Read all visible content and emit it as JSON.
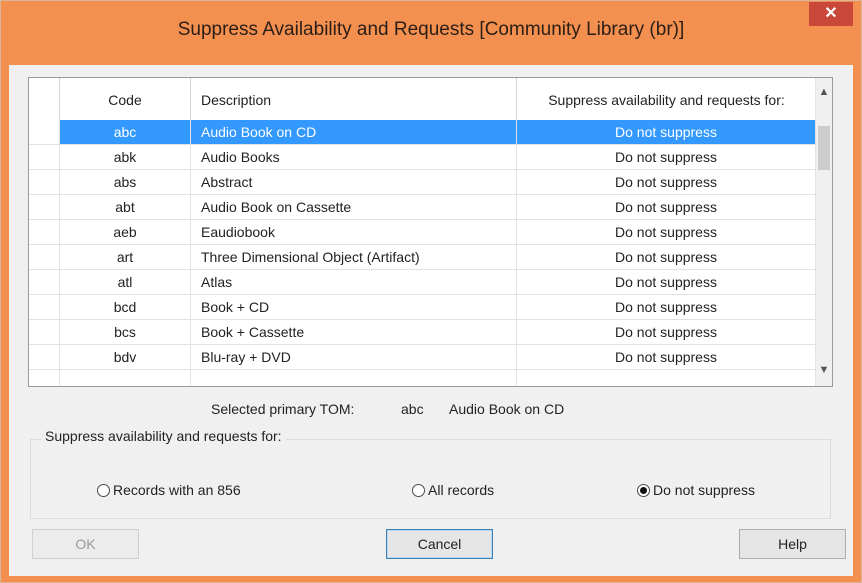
{
  "window": {
    "title": "Suppress Availability and Requests [Community Library  (br)]",
    "close_glyph": "✕"
  },
  "table": {
    "columns": [
      "Code",
      "Description",
      "Suppress availability and requests for:"
    ],
    "rows": [
      {
        "code": "abc",
        "description": "Audio Book on CD",
        "suppress": "Do not suppress",
        "selected": true
      },
      {
        "code": "abk",
        "description": "Audio Books",
        "suppress": "Do not suppress"
      },
      {
        "code": "abs",
        "description": "Abstract",
        "suppress": "Do not suppress"
      },
      {
        "code": "abt",
        "description": "Audio Book on Cassette",
        "suppress": "Do not suppress"
      },
      {
        "code": "aeb",
        "description": "Eaudiobook",
        "suppress": "Do not suppress"
      },
      {
        "code": "art",
        "description": "Three Dimensional Object (Artifact)",
        "suppress": "Do not suppress"
      },
      {
        "code": "atl",
        "description": "Atlas",
        "suppress": "Do not suppress"
      },
      {
        "code": "bcd",
        "description": "Book + CD",
        "suppress": "Do not suppress"
      },
      {
        "code": "bcs",
        "description": "Book + Cassette",
        "suppress": "Do not suppress"
      },
      {
        "code": "bdv",
        "description": "Blu-ray + DVD",
        "suppress": "Do not suppress"
      }
    ],
    "scroll_up_glyph": "▲",
    "scroll_down_glyph": "▼"
  },
  "selected_tom": {
    "label": "Selected primary TOM:",
    "code": "abc",
    "description": "Audio Book on CD"
  },
  "suppress_group": {
    "label": "Suppress availability and requests for:",
    "options": [
      {
        "label": "Records with an 856",
        "checked": false
      },
      {
        "label": "All records",
        "checked": false
      },
      {
        "label": "Do not suppress",
        "checked": true
      }
    ]
  },
  "buttons": {
    "ok": "OK",
    "cancel": "Cancel",
    "help": "Help"
  },
  "colors": {
    "frame": "#f3904f",
    "selection": "#3399ff",
    "close": "#c9483a"
  },
  "icons": [
    "close-icon",
    "scroll-up-icon",
    "scroll-down-icon"
  ]
}
